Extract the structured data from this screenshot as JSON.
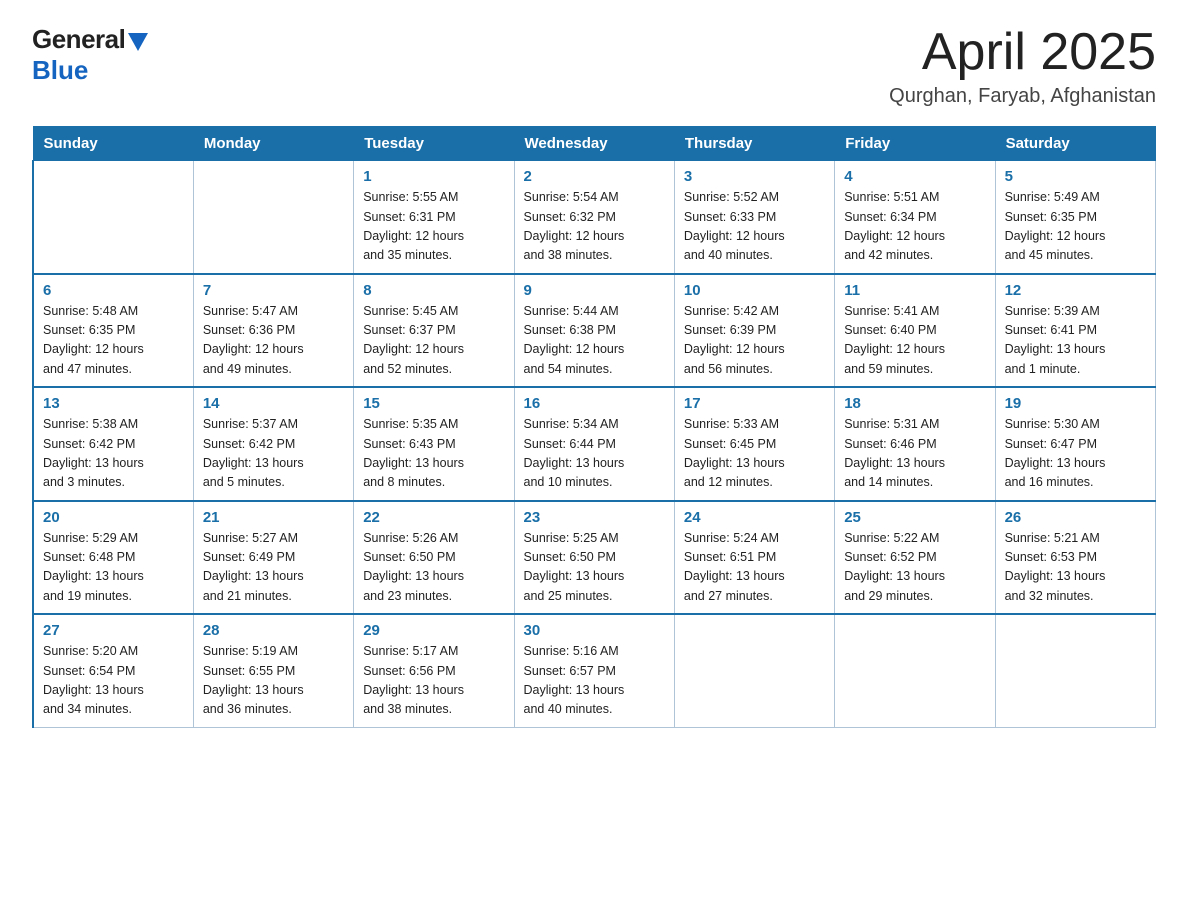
{
  "header": {
    "logo_general": "General",
    "logo_blue": "Blue",
    "month_title": "April 2025",
    "location": "Qurghan, Faryab, Afghanistan"
  },
  "days_of_week": [
    "Sunday",
    "Monday",
    "Tuesday",
    "Wednesday",
    "Thursday",
    "Friday",
    "Saturday"
  ],
  "weeks": [
    [
      {
        "day": "",
        "info": ""
      },
      {
        "day": "",
        "info": ""
      },
      {
        "day": "1",
        "info": "Sunrise: 5:55 AM\nSunset: 6:31 PM\nDaylight: 12 hours\nand 35 minutes."
      },
      {
        "day": "2",
        "info": "Sunrise: 5:54 AM\nSunset: 6:32 PM\nDaylight: 12 hours\nand 38 minutes."
      },
      {
        "day": "3",
        "info": "Sunrise: 5:52 AM\nSunset: 6:33 PM\nDaylight: 12 hours\nand 40 minutes."
      },
      {
        "day": "4",
        "info": "Sunrise: 5:51 AM\nSunset: 6:34 PM\nDaylight: 12 hours\nand 42 minutes."
      },
      {
        "day": "5",
        "info": "Sunrise: 5:49 AM\nSunset: 6:35 PM\nDaylight: 12 hours\nand 45 minutes."
      }
    ],
    [
      {
        "day": "6",
        "info": "Sunrise: 5:48 AM\nSunset: 6:35 PM\nDaylight: 12 hours\nand 47 minutes."
      },
      {
        "day": "7",
        "info": "Sunrise: 5:47 AM\nSunset: 6:36 PM\nDaylight: 12 hours\nand 49 minutes."
      },
      {
        "day": "8",
        "info": "Sunrise: 5:45 AM\nSunset: 6:37 PM\nDaylight: 12 hours\nand 52 minutes."
      },
      {
        "day": "9",
        "info": "Sunrise: 5:44 AM\nSunset: 6:38 PM\nDaylight: 12 hours\nand 54 minutes."
      },
      {
        "day": "10",
        "info": "Sunrise: 5:42 AM\nSunset: 6:39 PM\nDaylight: 12 hours\nand 56 minutes."
      },
      {
        "day": "11",
        "info": "Sunrise: 5:41 AM\nSunset: 6:40 PM\nDaylight: 12 hours\nand 59 minutes."
      },
      {
        "day": "12",
        "info": "Sunrise: 5:39 AM\nSunset: 6:41 PM\nDaylight: 13 hours\nand 1 minute."
      }
    ],
    [
      {
        "day": "13",
        "info": "Sunrise: 5:38 AM\nSunset: 6:42 PM\nDaylight: 13 hours\nand 3 minutes."
      },
      {
        "day": "14",
        "info": "Sunrise: 5:37 AM\nSunset: 6:42 PM\nDaylight: 13 hours\nand 5 minutes."
      },
      {
        "day": "15",
        "info": "Sunrise: 5:35 AM\nSunset: 6:43 PM\nDaylight: 13 hours\nand 8 minutes."
      },
      {
        "day": "16",
        "info": "Sunrise: 5:34 AM\nSunset: 6:44 PM\nDaylight: 13 hours\nand 10 minutes."
      },
      {
        "day": "17",
        "info": "Sunrise: 5:33 AM\nSunset: 6:45 PM\nDaylight: 13 hours\nand 12 minutes."
      },
      {
        "day": "18",
        "info": "Sunrise: 5:31 AM\nSunset: 6:46 PM\nDaylight: 13 hours\nand 14 minutes."
      },
      {
        "day": "19",
        "info": "Sunrise: 5:30 AM\nSunset: 6:47 PM\nDaylight: 13 hours\nand 16 minutes."
      }
    ],
    [
      {
        "day": "20",
        "info": "Sunrise: 5:29 AM\nSunset: 6:48 PM\nDaylight: 13 hours\nand 19 minutes."
      },
      {
        "day": "21",
        "info": "Sunrise: 5:27 AM\nSunset: 6:49 PM\nDaylight: 13 hours\nand 21 minutes."
      },
      {
        "day": "22",
        "info": "Sunrise: 5:26 AM\nSunset: 6:50 PM\nDaylight: 13 hours\nand 23 minutes."
      },
      {
        "day": "23",
        "info": "Sunrise: 5:25 AM\nSunset: 6:50 PM\nDaylight: 13 hours\nand 25 minutes."
      },
      {
        "day": "24",
        "info": "Sunrise: 5:24 AM\nSunset: 6:51 PM\nDaylight: 13 hours\nand 27 minutes."
      },
      {
        "day": "25",
        "info": "Sunrise: 5:22 AM\nSunset: 6:52 PM\nDaylight: 13 hours\nand 29 minutes."
      },
      {
        "day": "26",
        "info": "Sunrise: 5:21 AM\nSunset: 6:53 PM\nDaylight: 13 hours\nand 32 minutes."
      }
    ],
    [
      {
        "day": "27",
        "info": "Sunrise: 5:20 AM\nSunset: 6:54 PM\nDaylight: 13 hours\nand 34 minutes."
      },
      {
        "day": "28",
        "info": "Sunrise: 5:19 AM\nSunset: 6:55 PM\nDaylight: 13 hours\nand 36 minutes."
      },
      {
        "day": "29",
        "info": "Sunrise: 5:17 AM\nSunset: 6:56 PM\nDaylight: 13 hours\nand 38 minutes."
      },
      {
        "day": "30",
        "info": "Sunrise: 5:16 AM\nSunset: 6:57 PM\nDaylight: 13 hours\nand 40 minutes."
      },
      {
        "day": "",
        "info": ""
      },
      {
        "day": "",
        "info": ""
      },
      {
        "day": "",
        "info": ""
      }
    ]
  ]
}
